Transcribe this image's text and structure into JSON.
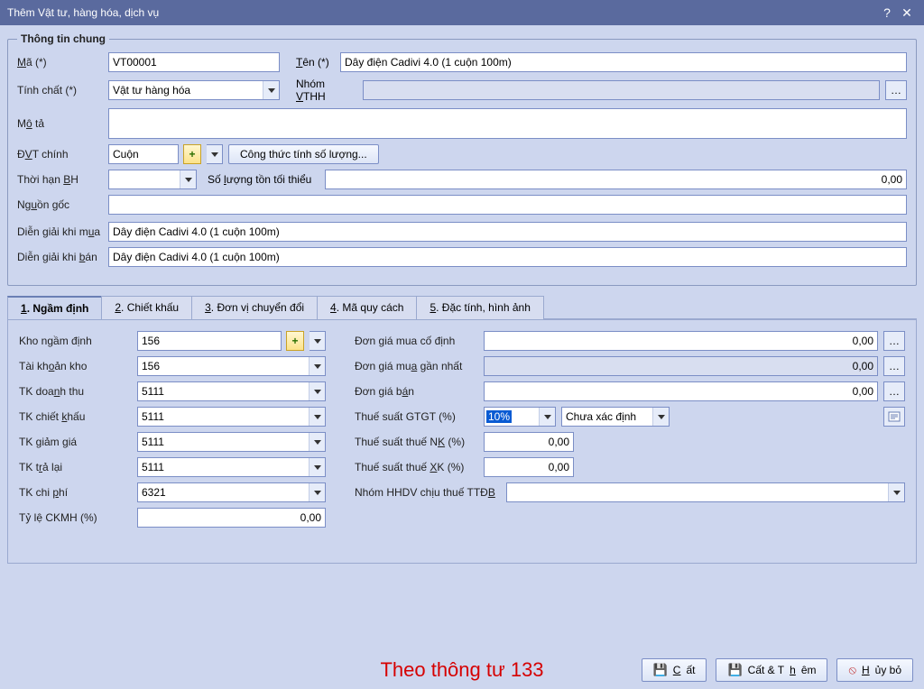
{
  "titlebar": {
    "title": "Thêm Vật tư, hàng hóa, dịch vụ"
  },
  "group1": {
    "legend": "Thông tin chung",
    "ma_label": "Mã (*)",
    "ma_value": "VT00001",
    "ten_label": "Tên (*)",
    "ten_value": "Dây điện Cadivi 4.0 (1 cuộn 100m)",
    "tinhchat_label": "Tính chất (*)",
    "tinhchat_value": "Vật tư hàng hóa",
    "nhom_label": "Nhóm VTHH",
    "nhom_value": "",
    "mota_label": "Mô tả",
    "mota_value": "",
    "dvt_label": "ĐVT chính",
    "dvt_value": "Cuộn",
    "congthuc_btn": "Công thức tính số lượng...",
    "thoihan_label": "Thời hạn BH",
    "thoihan_value": "",
    "sltt_label": "Số lượng tồn tối thiểu",
    "sltt_value": "0,00",
    "nguon_label": "Nguồn gốc",
    "nguon_value": "",
    "dgm_label": "Diễn giải khi mua",
    "dgm_value": "Dây điện Cadivi 4.0 (1 cuộn 100m)",
    "dgb_label": "Diễn giải khi bán",
    "dgb_value": "Dây điện Cadivi 4.0 (1 cuộn 100m)"
  },
  "tabs": [
    {
      "label": "1. Ngầm định"
    },
    {
      "label": "2. Chiết khấu"
    },
    {
      "label": "3. Đơn vị chuyển đổi"
    },
    {
      "label": "4. Mã quy cách"
    },
    {
      "label": "5. Đặc tính, hình ảnh"
    }
  ],
  "t1": {
    "kho_label": "Kho ngầm định",
    "kho_value": "156",
    "tkk_label": "Tài khoản kho",
    "tkk_value": "156",
    "tkdt_label": "TK doanh thu",
    "tkdt_value": "5111",
    "tkck_label": "TK chiết khấu",
    "tkck_value": "5111",
    "tkgg_label": "TK giảm giá",
    "tkgg_value": "5111",
    "tktl_label": "TK trả lại",
    "tktl_value": "5111",
    "tkcp_label": "TK chi phí",
    "tkcp_value": "6321",
    "tyle_label": "Tỷ lệ CKMH (%)",
    "tyle_value": "0,00",
    "dgmcd_label": "Đơn giá mua cố định",
    "dgmcd_value": "0,00",
    "dgmgn_label": "Đơn giá mua gần nhất",
    "dgmgn_value": "0,00",
    "dgban_label": "Đơn giá bán",
    "dgban_value": "0,00",
    "ts_label": "Thuế suất GTGT (%)",
    "ts_value": "10%",
    "ts_status": "Chưa xác định",
    "tsnk_label": "Thuế suất thuế NK (%)",
    "tsnk_value": "0,00",
    "tsxk_label": "Thuế suất thuế XK (%)",
    "tsxk_value": "0,00",
    "nhomttdb_label": "Nhóm HHDV chịu thuế TTĐB",
    "nhomttdb_value": ""
  },
  "buttons": {
    "save": "Cất",
    "savenew": "Cất & Thêm",
    "cancel": "Hủy bỏ"
  },
  "watermark": "Theo thông tư 133"
}
